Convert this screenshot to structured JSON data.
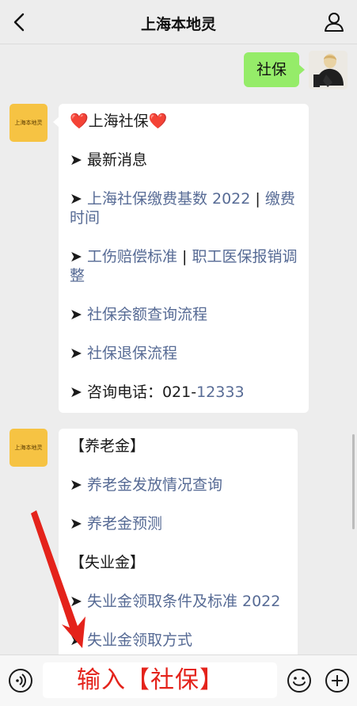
{
  "header": {
    "title": "上海本地灵"
  },
  "user_message": {
    "text": "社保"
  },
  "bot_avatar_label": "上海本地灵",
  "message1": {
    "title": "❤️上海社保❤️",
    "items": [
      {
        "prefix": "➤ ",
        "text": "最新消息",
        "link": false
      },
      {
        "prefix": "➤ ",
        "link_a": "上海社保缴费基数 2022",
        "sep": " | ",
        "link_b": "缴费时间"
      },
      {
        "prefix": "➤ ",
        "link_a": "工伤赔偿标准",
        "sep": " | ",
        "link_b": "职工医保报销调整"
      },
      {
        "prefix": "➤ ",
        "text": "社保余额查询流程",
        "link": true
      },
      {
        "prefix": "➤ ",
        "text": "社保退保流程",
        "link": true
      },
      {
        "prefix": "➤ ",
        "label": "咨询电话：021-",
        "number": "12333"
      }
    ]
  },
  "message2": {
    "section1": "【养老金】",
    "items1": [
      "养老金发放情况查询",
      "养老金预测"
    ],
    "section2": "【失业金】",
    "items2": [
      "失业金领取条件及标准 2022",
      "失业金领取方式"
    ]
  },
  "input": {
    "value": "输入【社保】"
  },
  "icons": {
    "back": "chevron-left-icon",
    "profile": "person-icon",
    "voice": "voice-icon",
    "emoji": "emoji-icon",
    "plus": "plus-icon",
    "annotation": "red-arrow-icon"
  },
  "colors": {
    "background": "#ededed",
    "user_bubble": "#95ec69",
    "link": "#576b95",
    "annotation": "#e4231b",
    "bot_avatar": "#f6c343"
  }
}
